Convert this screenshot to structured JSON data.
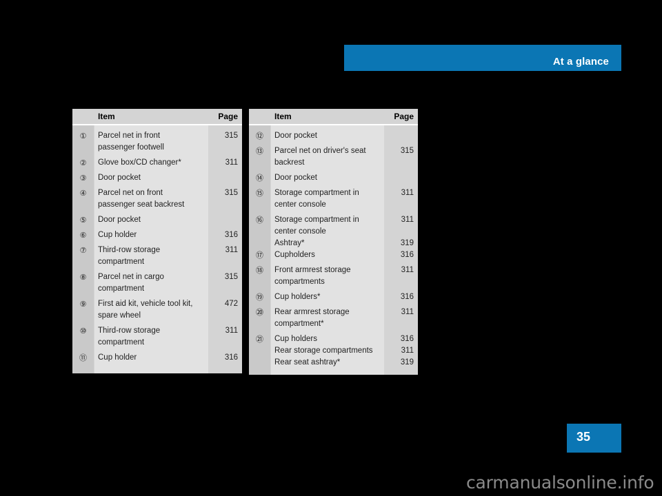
{
  "header": {
    "title": "At a glance",
    "bar_color": "#0b76b4"
  },
  "page_badge": {
    "number": "35",
    "color": "#0b76b4"
  },
  "watermark": {
    "text": "carmanualsonline.info",
    "color": "#8a8a8a"
  },
  "tables": [
    {
      "name": "legend-table-left",
      "columns": {
        "item": "Item",
        "page": "Page"
      },
      "rows": [
        {
          "num": "①",
          "line1": "Parcel net in front",
          "line2": "passenger footwell",
          "page": "315"
        },
        {
          "num": "②",
          "line1": "Glove box/CD changer*",
          "line2": "",
          "page": "311"
        },
        {
          "num": "③",
          "line1": "Door pocket",
          "line2": "",
          "page": ""
        },
        {
          "num": "④",
          "line1": "Parcel net on front",
          "line2": "passenger seat backrest",
          "page": "315"
        },
        {
          "num": "⑤",
          "line1": "Door pocket",
          "line2": "",
          "page": ""
        },
        {
          "num": "⑥",
          "line1": "Cup holder",
          "line2": "",
          "page": "316"
        },
        {
          "num": "⑦",
          "line1": "Third-row storage",
          "line2": "compartment",
          "page": "311"
        },
        {
          "num": "⑧",
          "line1": "Parcel net in cargo",
          "line2": "compartment",
          "page": "315"
        },
        {
          "num": "⑨",
          "line1": "First aid kit, vehicle tool kit,",
          "line2": "spare wheel",
          "page": "472"
        },
        {
          "num": "⑩",
          "line1": "Third-row storage",
          "line2": "compartment",
          "page": "311"
        },
        {
          "num": "⑪",
          "line1": "Cup holder",
          "line2": "",
          "page": "316"
        }
      ]
    },
    {
      "name": "legend-table-right",
      "columns": {
        "item": "Item",
        "page": "Page"
      },
      "rows": [
        {
          "num": "⑫",
          "line1": "Door pocket",
          "line2": "",
          "page": ""
        },
        {
          "num": "⑬",
          "line1": "Parcel net on driver's seat",
          "line2": "backrest",
          "page": "315"
        },
        {
          "num": "⑭",
          "line1": "Door pocket",
          "line2": "",
          "page": ""
        },
        {
          "num": "⑮",
          "line1": "Storage compartment in",
          "line2": "center console",
          "page": "311"
        },
        {
          "num": "⑯",
          "line1": "Storage compartment in",
          "line2": "center console",
          "page": "311"
        },
        {
          "num": "",
          "line1": "Ashtray*",
          "line2": "",
          "page": "319"
        },
        {
          "num": "⑰",
          "line1": "Cupholders",
          "line2": "",
          "page": "316"
        },
        {
          "num": "⑱",
          "line1": "Front armrest storage",
          "line2": "compartments",
          "page": "311"
        },
        {
          "num": "⑲",
          "line1": "Cup holders*",
          "line2": "",
          "page": "316"
        },
        {
          "num": "⑳",
          "line1": "Rear armrest storage",
          "line2": "compartment*",
          "page": "311"
        },
        {
          "num": "㉑",
          "line1": "Cup holders",
          "line2": "",
          "page": "316"
        },
        {
          "num": "",
          "line1": "Rear storage compartments",
          "line2": "",
          "page": "311"
        },
        {
          "num": "",
          "line1": "Rear seat ashtray*",
          "line2": "",
          "page": "319"
        }
      ]
    }
  ]
}
